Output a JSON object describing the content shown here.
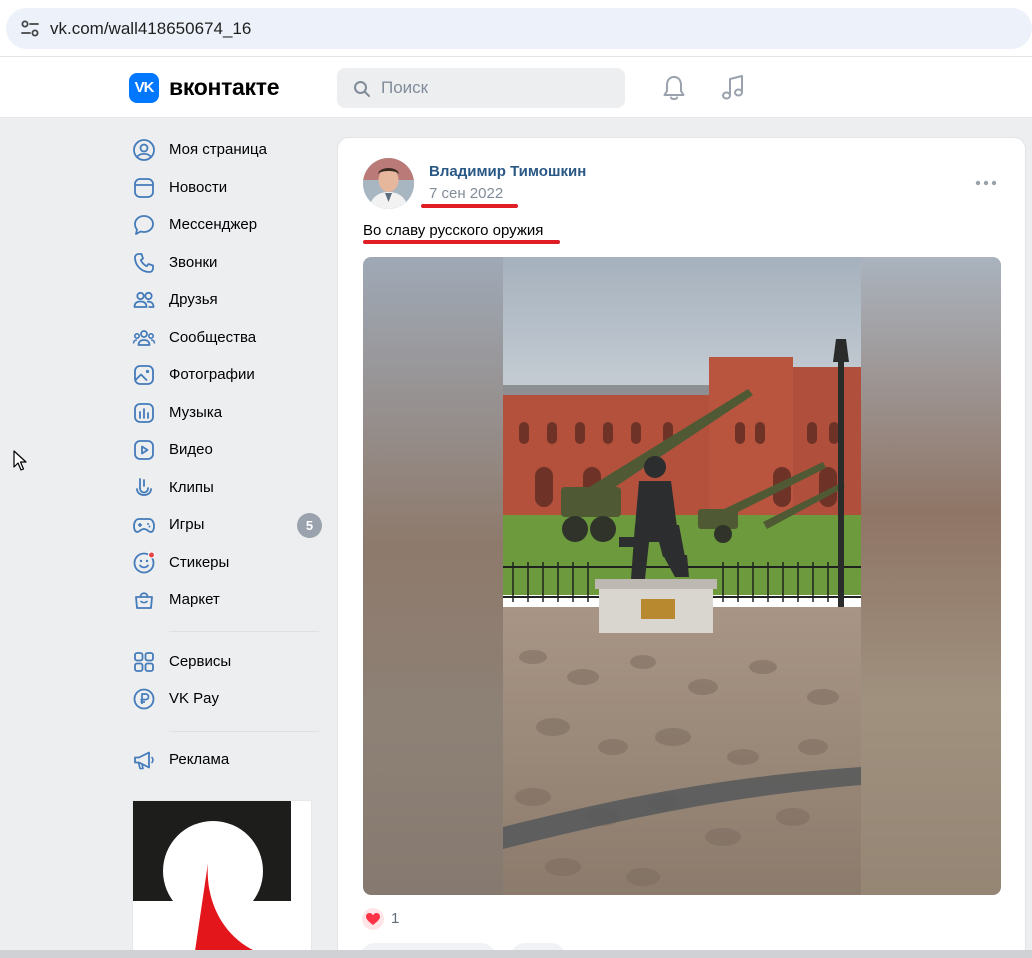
{
  "browser": {
    "url": "vk.com/wall418650674_16"
  },
  "header": {
    "logo_text": "VK",
    "brand": "вконтакте",
    "search_placeholder": "Поиск",
    "accent_color": "#0077ff"
  },
  "sidebar": {
    "items": [
      {
        "label": "Моя страница",
        "icon": "user-circle-icon"
      },
      {
        "label": "Новости",
        "icon": "news-icon"
      },
      {
        "label": "Мессенджер",
        "icon": "message-icon"
      },
      {
        "label": "Звонки",
        "icon": "phone-icon"
      },
      {
        "label": "Друзья",
        "icon": "friends-icon"
      },
      {
        "label": "Сообщества",
        "icon": "communities-icon"
      },
      {
        "label": "Фотографии",
        "icon": "photos-icon"
      },
      {
        "label": "Музыка",
        "icon": "music-icon"
      },
      {
        "label": "Видео",
        "icon": "video-icon"
      },
      {
        "label": "Клипы",
        "icon": "clips-icon"
      },
      {
        "label": "Игры",
        "icon": "gamepad-icon",
        "badge": "5"
      },
      {
        "label": "Стикеры",
        "icon": "stickers-icon"
      },
      {
        "label": "Маркет",
        "icon": "market-bag-icon"
      },
      {
        "label": "Сервисы",
        "icon": "services-grid-icon"
      },
      {
        "label": "VK Pay",
        "icon": "vkpay-icon"
      },
      {
        "label": "Реклама",
        "icon": "megaphone-icon"
      }
    ]
  },
  "post": {
    "author": "Владимир Тимошкин",
    "date": "7 сен 2022",
    "text": "Во славу русского оружия",
    "likes": "1",
    "like_color": "#ff3347",
    "highlight_color": "#e01c24"
  }
}
